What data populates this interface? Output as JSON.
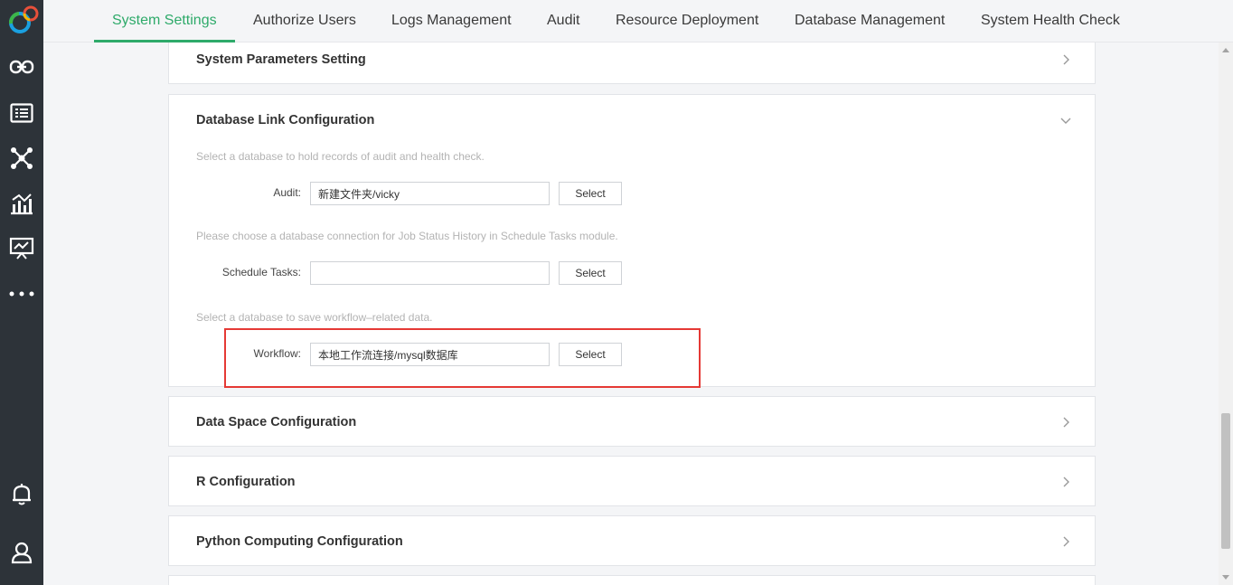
{
  "top_nav": {
    "tabs": [
      {
        "label": "System Settings",
        "active": true
      },
      {
        "label": "Authorize Users",
        "active": false
      },
      {
        "label": "Logs Management",
        "active": false
      },
      {
        "label": "Audit",
        "active": false
      },
      {
        "label": "Resource Deployment",
        "active": false
      },
      {
        "label": "Database Management",
        "active": false
      },
      {
        "label": "System Health Check",
        "active": false
      }
    ]
  },
  "sidebar": {
    "icons": [
      "logo-icon",
      "link-icon",
      "list-icon",
      "network-icon",
      "chart-icon",
      "presentation-icon",
      "more-icon",
      "bell-icon",
      "user-icon"
    ]
  },
  "sections": {
    "system_params": {
      "title": "System Parameters Setting",
      "state": "collapsed"
    },
    "db_link": {
      "title": "Database Link Configuration",
      "state": "expanded",
      "audit_hint": "Select a database to hold records of audit and health check.",
      "audit_label": "Audit:",
      "audit_value": "新建文件夹/vicky",
      "audit_button": "Select",
      "schedule_hint": "Please choose a database connection for Job Status History in Schedule Tasks module.",
      "schedule_label": "Schedule Tasks:",
      "schedule_value": "",
      "schedule_button": "Select",
      "workflow_hint": "Select a database to save workflow–related data.",
      "workflow_label": "Workflow:",
      "workflow_value": "本地工作流连接/mysql数据库",
      "workflow_button": "Select"
    },
    "data_space": {
      "title": "Data Space Configuration",
      "state": "collapsed"
    },
    "r_config": {
      "title": "R Configuration",
      "state": "collapsed"
    },
    "python_config": {
      "title": "Python Computing Configuration",
      "state": "collapsed"
    }
  },
  "colors": {
    "accent": "#2eaa6a",
    "sidebar_bg": "#2d3339",
    "highlight": "#e53935"
  }
}
